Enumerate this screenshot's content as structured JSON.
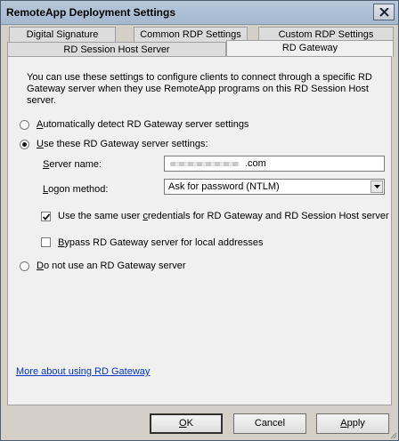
{
  "window": {
    "title": "RemoteApp Deployment Settings"
  },
  "tabs": {
    "row1": [
      "Digital Signature",
      "Common RDP Settings",
      "Custom RDP Settings"
    ],
    "row2": [
      "RD Session Host Server",
      "RD Gateway"
    ],
    "active": "RD Gateway"
  },
  "panel": {
    "description": "You can use these settings to configure clients to connect through a specific RD Gateway server when they use RemoteApp programs on this RD Session Host server.",
    "options": {
      "auto_detect": {
        "label": "Automatically detect RD Gateway server settings",
        "accel": "A",
        "rest": "utomatically detect RD Gateway server settings",
        "selected": false
      },
      "use_these": {
        "label": "Use these RD Gateway server settings:",
        "accel": "U",
        "rest": "se these RD Gateway server settings:",
        "selected": true
      },
      "do_not_use": {
        "label": "Do not use an RD Gateway server",
        "accel": "D",
        "rest": "o not use an RD Gateway server",
        "selected": false
      }
    },
    "server_name": {
      "label": "Server name:",
      "accel": "S",
      "rest": "erver name:",
      "value": ".com"
    },
    "logon_method": {
      "label": "Logon method:",
      "accel": "L",
      "rest": "ogon method:",
      "value": "Ask for password (NTLM)"
    },
    "same_credentials": {
      "pre": "Use the same user ",
      "accel": "c",
      "rest": "redentials for RD Gateway and RD Session Host server",
      "checked": true
    },
    "bypass_local": {
      "accel": "B",
      "rest": "ypass RD Gateway server for local addresses",
      "checked": false
    },
    "help_link": "More about using RD Gateway"
  },
  "buttons": {
    "ok": {
      "accel": "O",
      "rest": "K"
    },
    "cancel": {
      "accel": "",
      "label": "Cancel"
    },
    "apply": {
      "accel": "A",
      "rest": "pply"
    }
  }
}
